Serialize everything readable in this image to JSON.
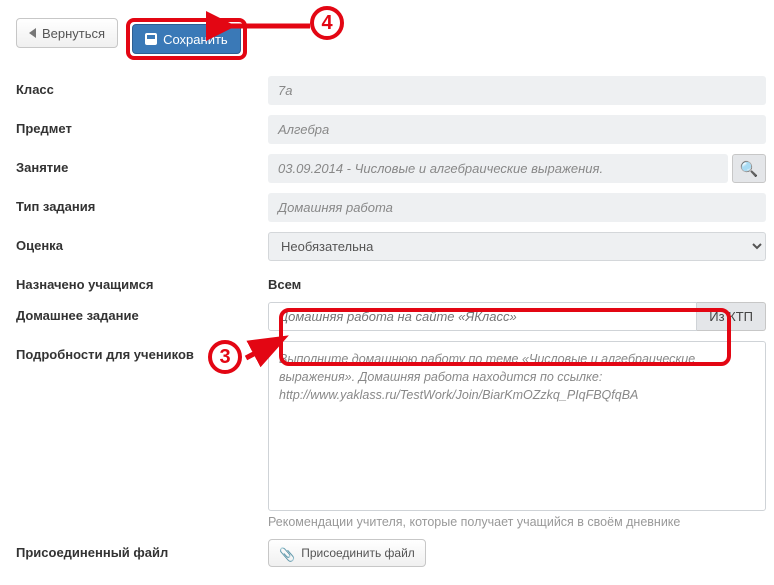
{
  "topbar": {
    "back_label": "Вернуться",
    "save_label": "Сохранить"
  },
  "labels": {
    "class": "Класс",
    "subject": "Предмет",
    "lesson": "Занятие",
    "task_type": "Тип задания",
    "grade": "Оценка",
    "assigned": "Назначено учащимся",
    "homework": "Домашнее задание",
    "details": "Подробности для учеников",
    "attachment": "Присоединенный файл"
  },
  "values": {
    "class": "7а",
    "subject": "Алгебра",
    "lesson": "03.09.2014 - Числовые и алгебраические выражения.",
    "task_type": "Домашняя работа",
    "grade": "Необязательна",
    "assigned": "Всем",
    "homework_placeholder": "Домашняя работа на сайте «ЯКласс»",
    "from_ktp": "Из КТП",
    "details_text": "Выполните домашнюю работу по теме «Числовые и алгебраические выражения». Домашняя работа находится по ссылке: http://www.yaklass.ru/TestWork/Join/BiarKmOZzkq_PIqFBQfqBA",
    "details_hint": "Рекомендации учителя, которые получает учащийся в своём дневнике",
    "attach_btn": "Присоединить файл"
  },
  "callouts": {
    "n3": "3",
    "n4": "4"
  }
}
